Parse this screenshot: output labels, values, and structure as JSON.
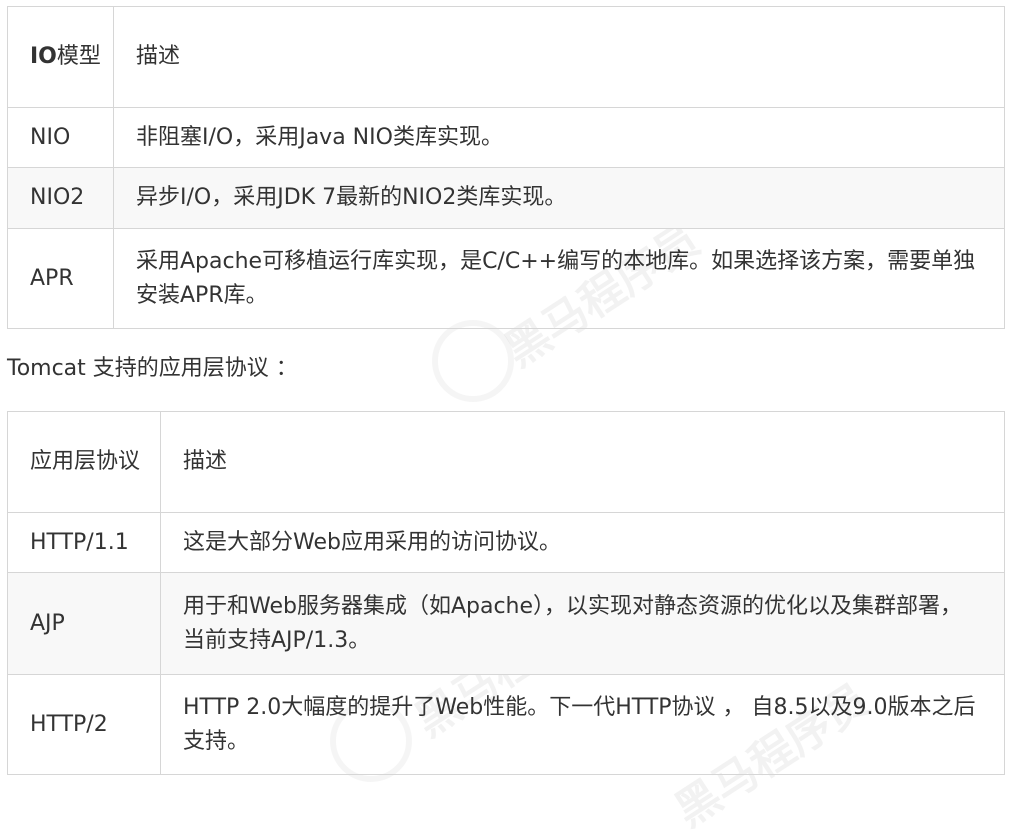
{
  "table1": {
    "header": {
      "col1_bold": "IO",
      "col1_rest": "模型",
      "col2": "描述"
    },
    "rows": [
      {
        "name": "NIO",
        "desc": "非阻塞I/O，采用Java NIO类库实现。"
      },
      {
        "name": "NIO2",
        "desc": "异步I/O，采用JDK 7最新的NIO2类库实现。"
      },
      {
        "name": "APR",
        "desc": "采用Apache可移植运行库实现，是C/C++编写的本地库。如果选择该方案，需要单独安装APR库。"
      }
    ]
  },
  "subtitle": "Tomcat 支持的应用层协议 ：",
  "table2": {
    "header": {
      "col1": "应用层协议",
      "col2": "描述"
    },
    "rows": [
      {
        "name": "HTTP/1.1",
        "desc": "这是大部分Web应用采用的访问协议。"
      },
      {
        "name": "AJP",
        "desc": "用于和Web服务器集成（如Apache），以实现对静态资源的优化以及集群部署，当前支持AJP/1.3。"
      },
      {
        "name": "HTTP/2",
        "desc": "HTTP 2.0大幅度的提升了Web性能。下一代HTTP协议 ， 自8.5以及9.0版本之后支持。"
      }
    ]
  },
  "watermark": "黑马程序员"
}
